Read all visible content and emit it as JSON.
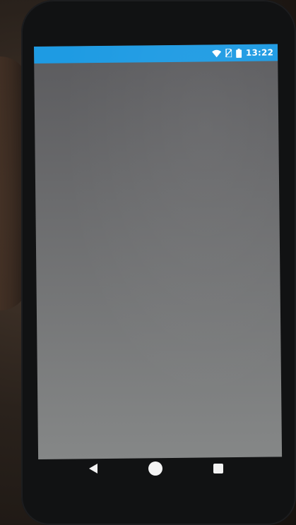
{
  "status_bar": {
    "time": "13:22",
    "color": "#1e9be3",
    "icons": [
      "wifi-icon",
      "no-sim-icon",
      "battery-icon"
    ]
  },
  "content": {
    "background_top": "#5b5b5e",
    "background_bottom": "#858787"
  },
  "nav_bar": {
    "buttons": [
      "back-icon",
      "home-icon",
      "recents-icon"
    ]
  }
}
